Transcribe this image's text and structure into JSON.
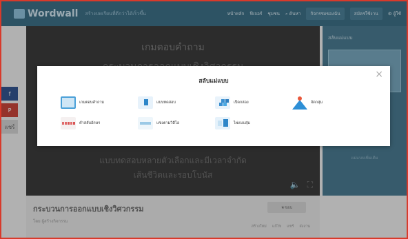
{
  "header": {
    "logo": "Wordwall",
    "tagline": "สร้างบทเรียนที่ดีกว่าได้เร็วขึ้น",
    "nav": [
      "หน้าหลัก",
      "ฟีเจอร์",
      "ชุมชน",
      "ค้นหา"
    ],
    "my_activities": "กิจกรรมของฉัน",
    "subscribe": "สมัครใช้งาน",
    "user": "ผู้ใช้"
  },
  "share": {
    "facebook": "f",
    "pinterest": "P",
    "more": "แชร์"
  },
  "game": {
    "title_line1": "เกมตอบคำถาม",
    "title_line2": "กระบวนการออกแบบเชิงวิศวกรรม",
    "desc_line1": "แบบทดสอบหลายตัวเลือกและมีเวลาจำกัด",
    "desc_line2": "เส้นชีวิตและรอบโบนัส"
  },
  "right_panel": {
    "title": "สลับแม่แบบ",
    "note": "แม่แบบเพิ่มเติม"
  },
  "activity": {
    "title": "กระบวนการออกแบบเชิงวิศวกรรม",
    "author": "โดย ผู้สร้างกิจกรรม",
    "like": "ชอบ",
    "actions": [
      "สร้างใหม่",
      "แก้ไข",
      "แชร์",
      "ส่งงาน"
    ]
  },
  "modal": {
    "title": "สลับแม่แบบ",
    "close": "×",
    "templates": [
      {
        "label": "เกมตอบคำถาม",
        "icon": "quiz-icon"
      },
      {
        "label": "แบบทดสอบ",
        "icon": "match-up-icon"
      },
      {
        "label": "เปิดกล่อง",
        "icon": "open-box-icon"
      },
      {
        "label": "จัดกลุ่ม",
        "icon": "group-sort-icon"
      },
      {
        "label": "คำสลับอักษร",
        "icon": "anagram-icon"
      },
      {
        "label": "แข่งตามวิดีโอ",
        "icon": "match-pairs-icon"
      },
      {
        "label": "ไพ่แบบสุ่ม",
        "icon": "random-cards-icon"
      }
    ]
  }
}
